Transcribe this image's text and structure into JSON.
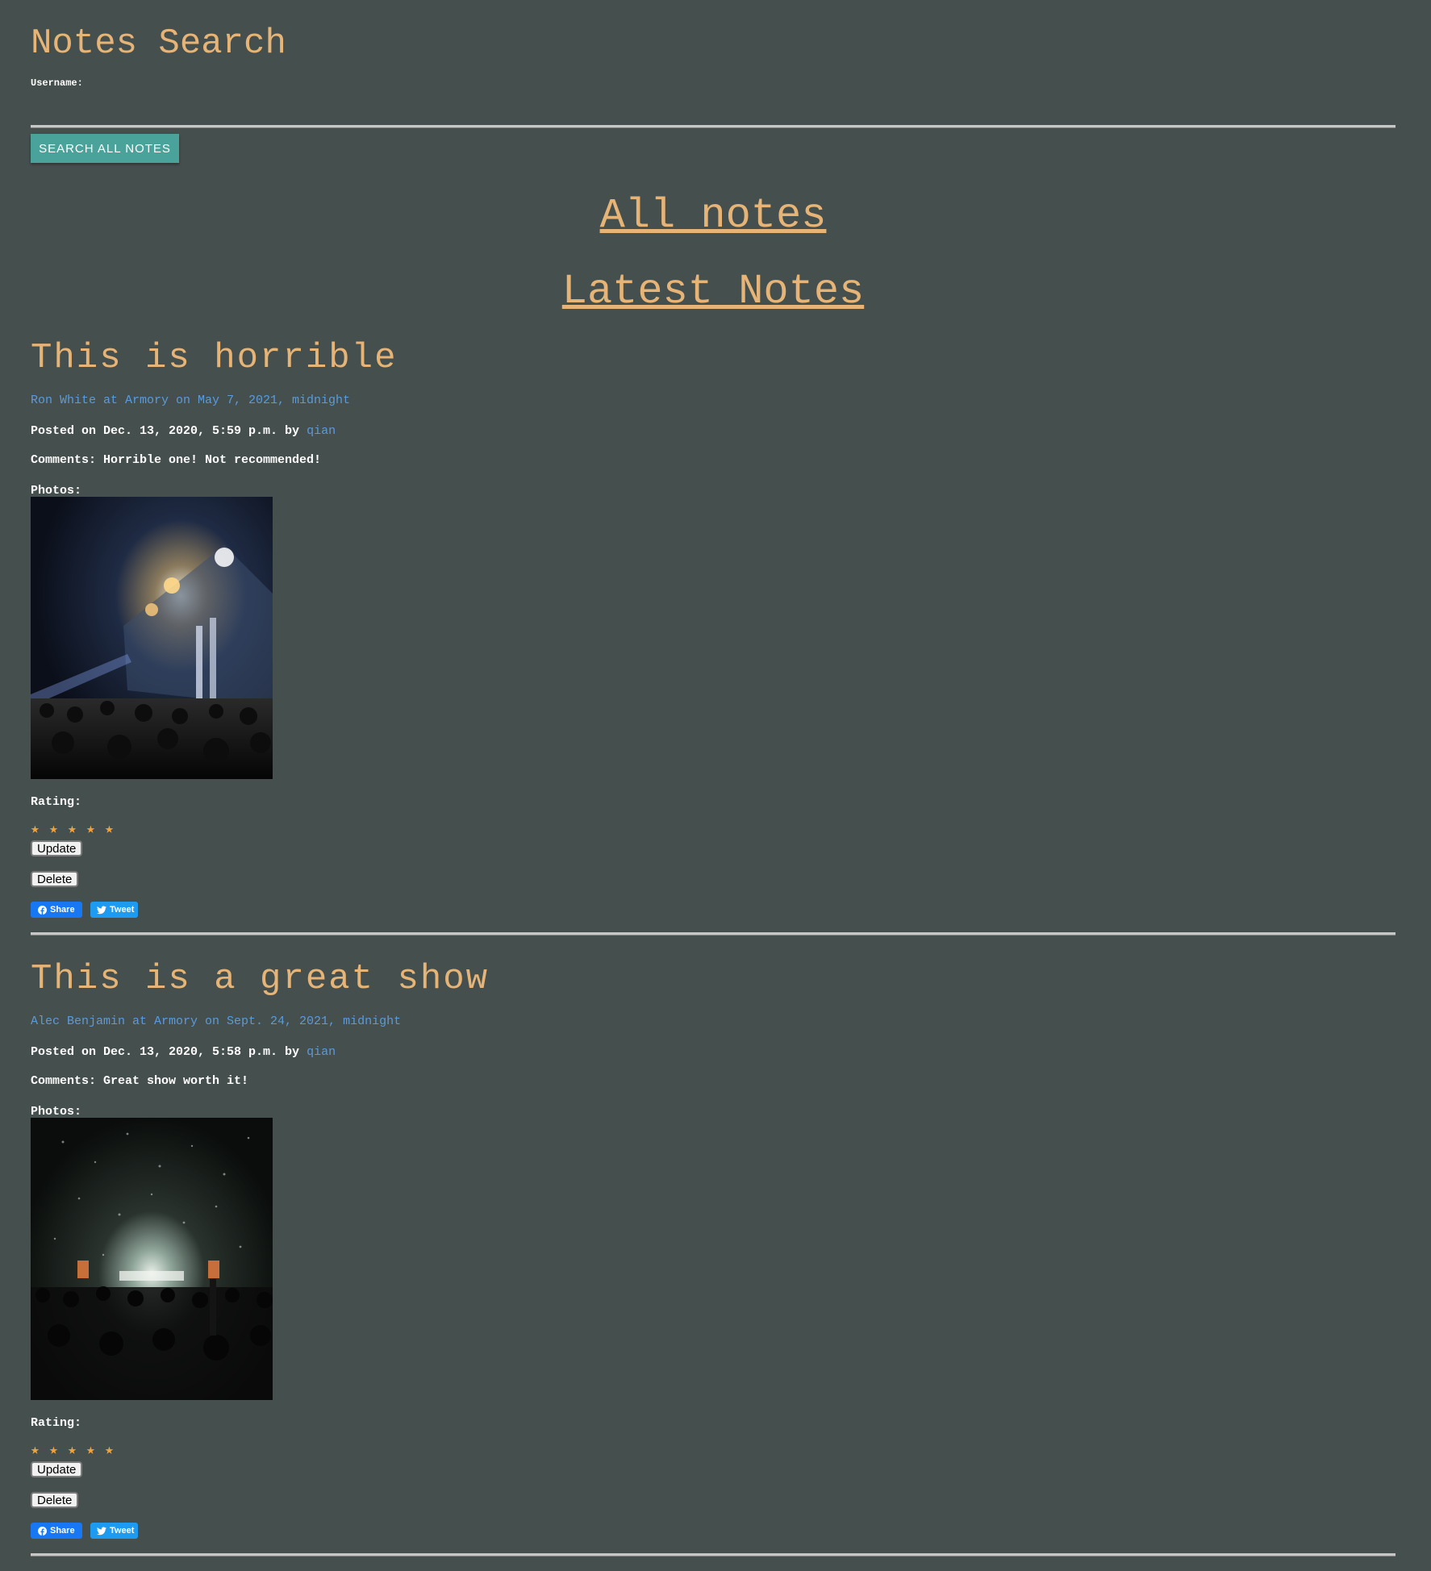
{
  "header": {
    "title": "Notes Search",
    "username_label": "Username:",
    "search_button": "SEARCH ALL NOTES"
  },
  "nav": {
    "all_notes": "All notes",
    "latest_notes": "Latest Notes"
  },
  "notes": [
    {
      "title": "This is horrible",
      "event": "Ron White at Armory on May 7, 2021, midnight",
      "posted_prefix": "Posted on Dec. 13, 2020, 5:59 p.m. by",
      "user": "qian",
      "comments": "Comments: Horrible one! Not recommended!",
      "photos_label": "Photos:",
      "rating_label": "Rating:",
      "rating_value": 5,
      "rating_max": 5,
      "update_label": "Update",
      "delete_label": "Delete",
      "share_label": "Share",
      "tweet_label": "Tweet"
    },
    {
      "title": "This is a great show",
      "event": "Alec Benjamin at Armory on Sept. 24, 2021, midnight",
      "posted_prefix": "Posted on Dec. 13, 2020, 5:58 p.m. by",
      "user": "qian",
      "comments": "Comments: Great show worth it!",
      "photos_label": "Photos:",
      "rating_label": "Rating:",
      "rating_value": 5,
      "rating_max": 5,
      "update_label": "Update",
      "delete_label": "Delete",
      "share_label": "Share",
      "tweet_label": "Tweet"
    }
  ],
  "colors": {
    "background": "#454f4d",
    "heading": "#e6b477",
    "link": "#5b9bdc",
    "star": "#f0a23c",
    "search_button": "#4aa39a"
  }
}
